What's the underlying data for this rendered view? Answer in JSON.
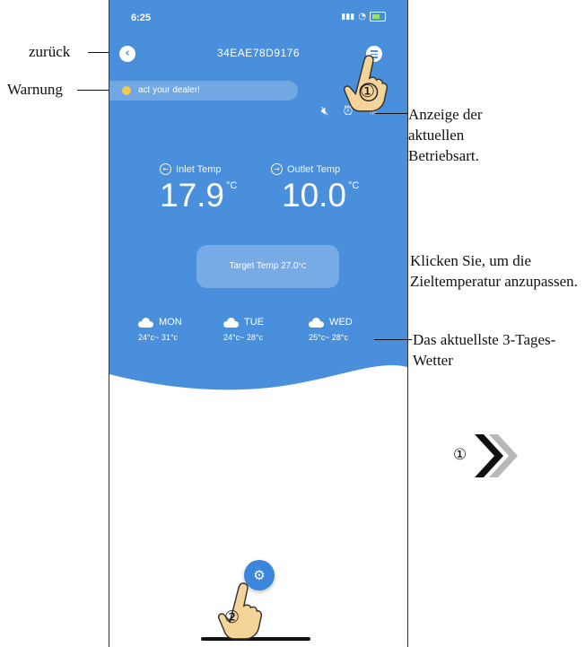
{
  "annotations": {
    "back": "zurück",
    "warning": "Warnung",
    "mode_display": "Anzeige der aktuellen Betriebsart.",
    "target_hint": "Klicken Sie, um die Zieltemperatur anzupassen.",
    "weather_hint": "Das aktuellste 3-Tages-Wetter",
    "step_next": "①",
    "step1": "①",
    "step2": "②"
  },
  "status_bar": {
    "time": "6:25"
  },
  "header": {
    "device_id": "34EAE78D9176"
  },
  "warning": {
    "text": "act your dealer!"
  },
  "temps": {
    "inlet_label": "Inlet Temp",
    "inlet_value": "17.9",
    "outlet_label": "Outlet Temp",
    "outlet_value": "10.0",
    "unit": "°C"
  },
  "target": {
    "label": "Target Temp",
    "value": "27.0",
    "unit": "°C"
  },
  "weather": [
    {
      "day": "MON",
      "range": "24°c~ 31°c"
    },
    {
      "day": "TUE",
      "range": "24°c~ 28°c"
    },
    {
      "day": "WED",
      "range": "25°c~ 28°c"
    }
  ],
  "colors": {
    "accent": "#4a8fdc",
    "warning_dot": "#f2c94c"
  },
  "icons": {
    "back": "chevron-left-icon",
    "menu": "menu-icon",
    "mute": "speaker-mute-icon",
    "timer": "alarm-clock-icon",
    "mode": "sun-icon",
    "settings": "gear-icon",
    "weather": "cloud-icon"
  }
}
